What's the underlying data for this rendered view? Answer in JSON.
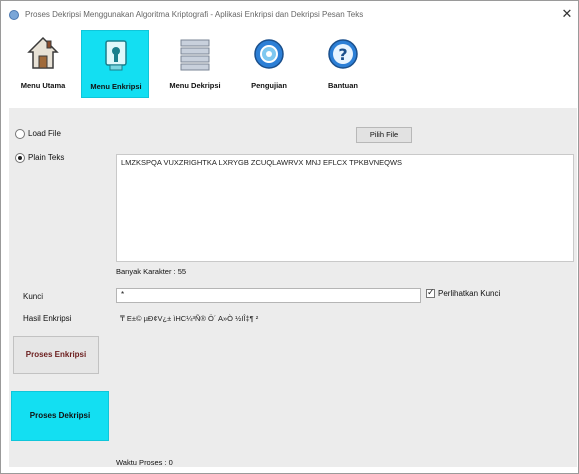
{
  "window": {
    "title": "Proses Dekripsi Menggunakan Algoritma Kriptografi - Aplikasi Enkripsi dan Dekripsi Pesan Teks",
    "close_glyph": "✕"
  },
  "toolbar": {
    "items": [
      {
        "label": "Menu Utama",
        "icon": "home-icon"
      },
      {
        "label": "Menu Enkripsi",
        "icon": "encrypt-icon",
        "active": true
      },
      {
        "label": "Menu Dekripsi",
        "icon": "document-icon"
      },
      {
        "label": "Pengujian",
        "icon": "test-icon"
      },
      {
        "label": "Bantuan",
        "icon": "help-icon"
      }
    ]
  },
  "form": {
    "option_file": "Load File",
    "option_text": "Plain Teks",
    "selected_option": "Plain Teks",
    "browse_button": "Pilih File",
    "plaintext": "LMZKSPQA VUXZRIGHTKA LXRYGB ZCUQLAWRVX MNJ EFLCX TPKBVNEQWS",
    "char_count_label": "Banyak Karakter : 55",
    "key_label": "Kunci",
    "key_value": "*",
    "show_key_label": "Perlihatkan Kunci",
    "show_key_checked": true,
    "result_label": "Hasil Enkripsi",
    "result_text": "  ₸ E±© µÐ¢V¿± ìHC¼³Ñ® Ö´ A»Ò ½IÎ‡¶ ²",
    "time_label": "Waktu Proses : 0"
  },
  "actions": {
    "encrypt_button": "Proses Enkripsi",
    "decrypt_button": "Proses Dekripsi"
  },
  "colors": {
    "accent": "#13dff2",
    "panel": "#ececec"
  }
}
